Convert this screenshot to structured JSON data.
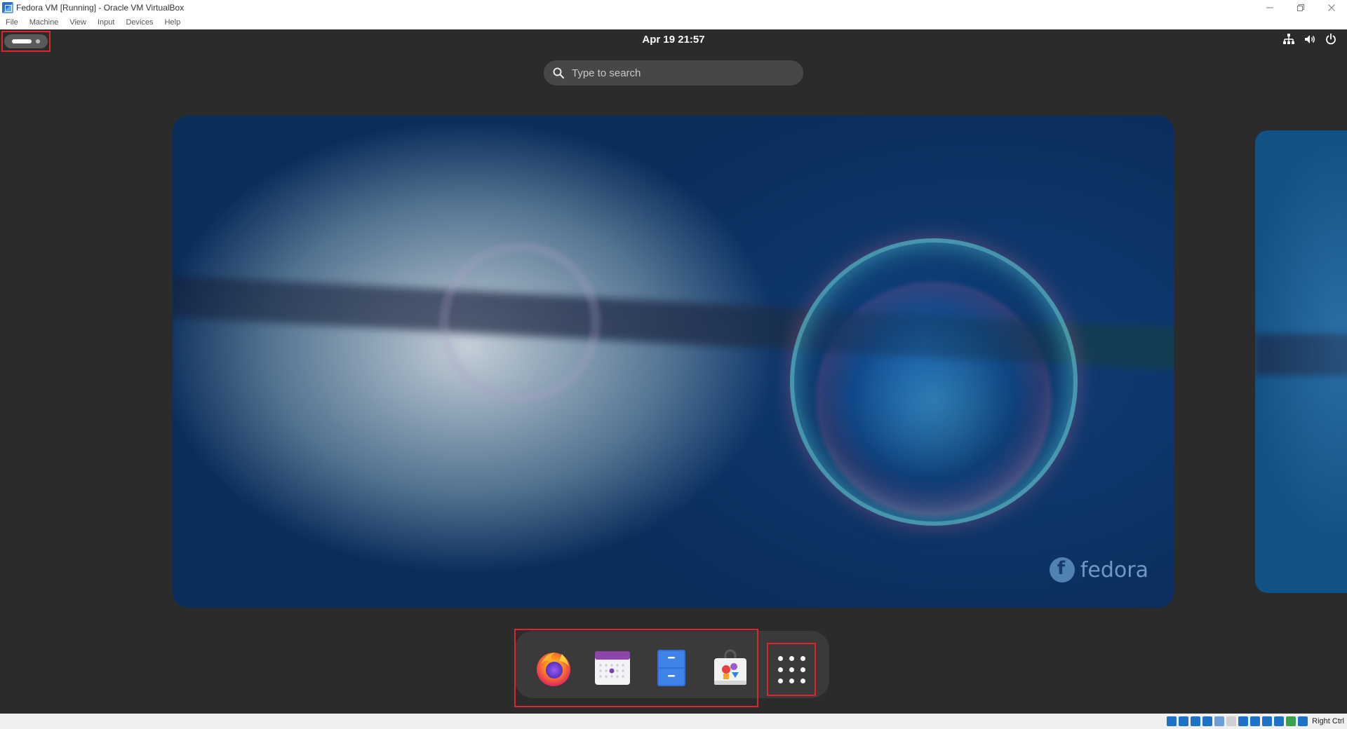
{
  "window": {
    "title": "Fedora VM [Running] - Oracle VM VirtualBox",
    "controls": [
      "minimize-icon",
      "restore-icon",
      "close-icon"
    ]
  },
  "menubar": {
    "items": [
      "File",
      "Machine",
      "View",
      "Input",
      "Devices",
      "Help"
    ]
  },
  "topbar": {
    "activities_icon": "activities-indicator-icon",
    "clock": "Apr 19  21:57",
    "status_icons": [
      "network-icon",
      "volume-icon",
      "power-icon"
    ]
  },
  "search": {
    "placeholder": "Type to search",
    "icon": "search-icon"
  },
  "workspace": {
    "wallpaper_brand": "fedora"
  },
  "dash": {
    "apps": [
      {
        "name": "Firefox",
        "icon": "firefox-icon"
      },
      {
        "name": "Calendar",
        "icon": "calendar-icon"
      },
      {
        "name": "Files",
        "icon": "files-icon"
      },
      {
        "name": "Software",
        "icon": "software-icon"
      }
    ],
    "show_apps_icon": "show-apps-grid-icon"
  },
  "host_status": {
    "host_key": "Right Ctrl",
    "tray_colors": [
      "#1e73c8",
      "#1e73c8",
      "#1e73c8",
      "#1e73c8",
      "#6a9ed8",
      "#d0d0d0",
      "#1e73c8",
      "#1e73c8",
      "#1e73c8",
      "#1e73c8",
      "#3aa24a",
      "#1e73c8"
    ]
  },
  "colors": {
    "highlight": "#e0242b",
    "shell_bg": "#2b2b2b",
    "dash_bg": "#3a3a3a"
  }
}
